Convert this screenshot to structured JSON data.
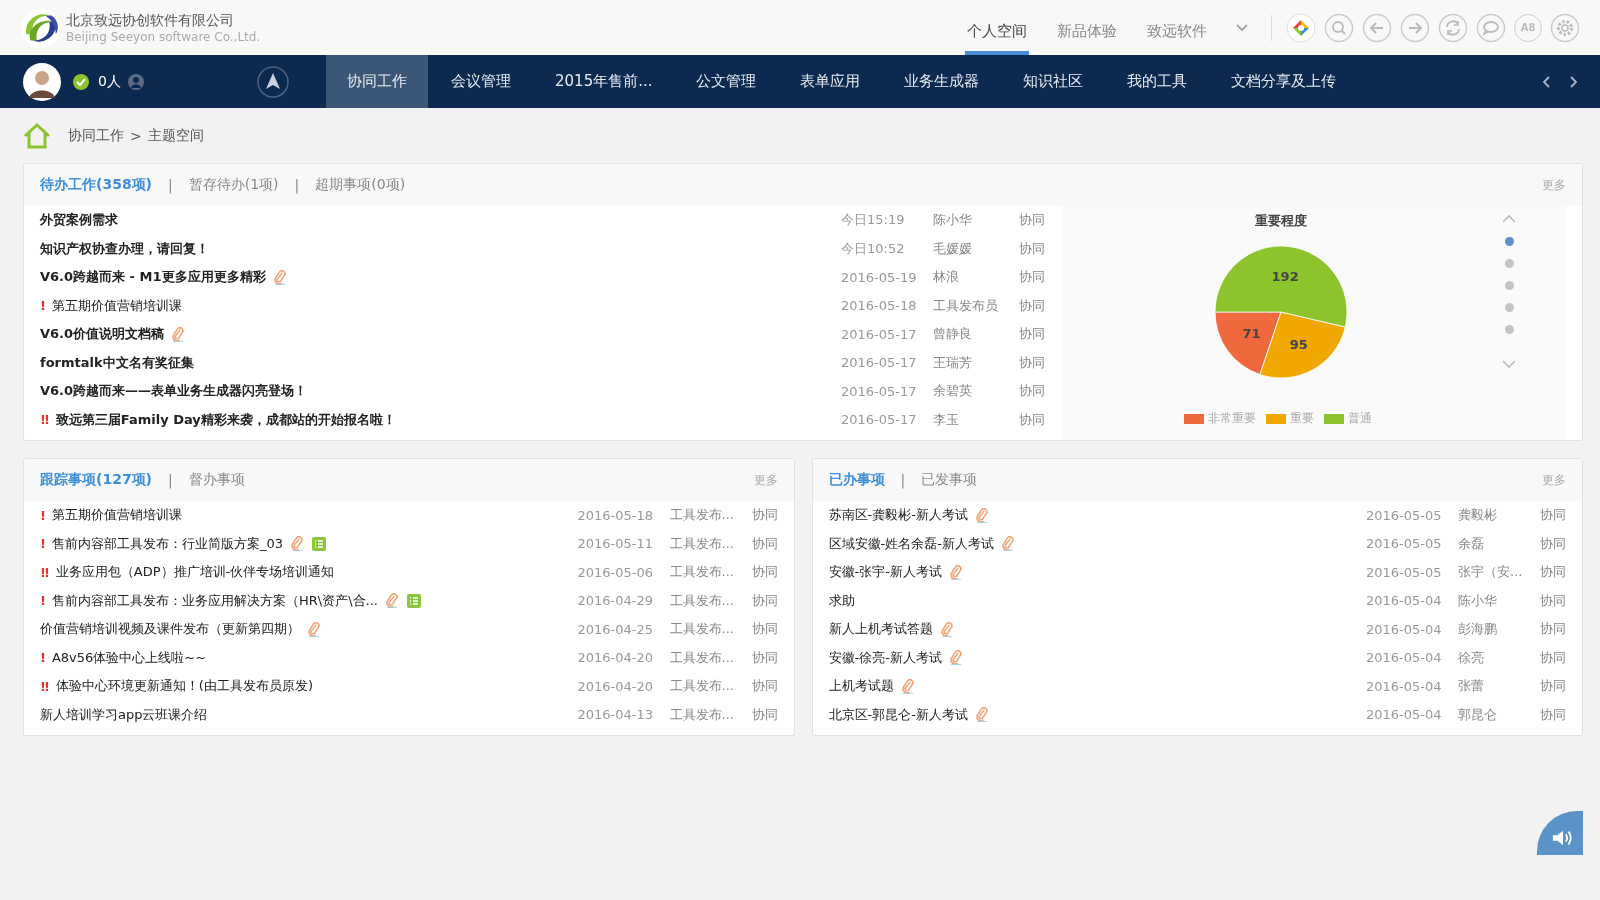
{
  "company": {
    "name": "北京致远协创软件有限公司",
    "name_en": "Beijing Seeyon software Co.,Ltd."
  },
  "top_nav": [
    {
      "label": "个人空间",
      "selected": true
    },
    {
      "label": "新品体验",
      "selected": false
    },
    {
      "label": "致远软件",
      "selected": false
    }
  ],
  "toolbar_badge": "A8",
  "user": {
    "online_count": "0人"
  },
  "main_nav": [
    {
      "label": "协同工作",
      "selected": true
    },
    {
      "label": "会议管理",
      "selected": false
    },
    {
      "label": "2015年售前...",
      "selected": false
    },
    {
      "label": "公文管理",
      "selected": false
    },
    {
      "label": "表单应用",
      "selected": false
    },
    {
      "label": "业务生成器",
      "selected": false
    },
    {
      "label": "知识社区",
      "selected": false
    },
    {
      "label": "我的工具",
      "selected": false
    },
    {
      "label": "文档分享及上传",
      "selected": false
    }
  ],
  "breadcrumb": [
    "协同工作",
    "主题空间"
  ],
  "breadcrumb_separator": ">",
  "pending": {
    "separator": "|",
    "tabs": [
      {
        "label": "待办工作(358项)",
        "selected": true
      },
      {
        "label": "暂存待办(1项)",
        "selected": false
      },
      {
        "label": "超期事项(0项)",
        "selected": false
      }
    ],
    "more": "更多",
    "rows": [
      {
        "title": "外贸案例需求",
        "bold": true,
        "attachment": false,
        "form": false,
        "date": "今日15:19",
        "person": "陈小华",
        "type": "协同"
      },
      {
        "title": "知识产权协查办理，请回复！",
        "bold": true,
        "attachment": false,
        "form": false,
        "date": "今日10:52",
        "person": "毛媛媛",
        "type": "协同"
      },
      {
        "title": "V6.0跨越而来 - M1更多应用更多精彩",
        "bold": true,
        "attachment": true,
        "form": false,
        "date": "2016-05-19",
        "person": "林浪",
        "type": "协同"
      },
      {
        "flag": "!",
        "title": "第五期价值营销培训课",
        "bold": false,
        "attachment": false,
        "form": false,
        "date": "2016-05-18",
        "person": "工具发布员",
        "type": "协同"
      },
      {
        "title": "V6.0价值说明文档稿",
        "bold": true,
        "attachment": true,
        "form": false,
        "date": "2016-05-17",
        "person": "曾静良",
        "type": "协同"
      },
      {
        "title": "formtalk中文名有奖征集",
        "bold": true,
        "attachment": false,
        "form": false,
        "date": "2016-05-17",
        "person": "王瑞芳",
        "type": "协同"
      },
      {
        "title": "V6.0跨越而来——表单业务生成器闪亮登场！",
        "bold": true,
        "attachment": false,
        "form": false,
        "date": "2016-05-17",
        "person": "余碧英",
        "type": "协同"
      },
      {
        "flag": "!!",
        "title": "致远第三届Family Day精彩来袭，成都站的开始报名啦！",
        "bold": true,
        "attachment": false,
        "form": false,
        "date": "2016-05-17",
        "person": "李玉",
        "type": "协同"
      }
    ],
    "chart_data": {
      "type": "pie",
      "title": "重要程度",
      "categories": [
        "非常重要",
        "重要",
        "普通"
      ],
      "values": [
        71,
        95,
        192
      ],
      "colors": [
        "#f0683e",
        "#f0a800",
        "#8dc42e"
      ],
      "data_labels": true,
      "legend": "bottom"
    },
    "pager": [
      {
        "selected": true
      },
      {
        "selected": false
      },
      {
        "selected": false
      },
      {
        "selected": false
      },
      {
        "selected": false
      }
    ]
  },
  "tracking": {
    "separator": "|",
    "tabs": [
      {
        "label": "跟踪事项(127项)",
        "selected": true
      },
      {
        "label": "督办事项",
        "selected": false
      }
    ],
    "more": "更多",
    "rows": [
      {
        "flag": "!",
        "title": "第五期价值营销培训课",
        "bold": false,
        "attachment": false,
        "form": false,
        "date": "2016-05-18",
        "person": "工具发布...",
        "type": "协同"
      },
      {
        "flag": "!",
        "title": "售前内容部工具发布：行业简版方案_03",
        "bold": false,
        "attachment": true,
        "form": true,
        "date": "2016-05-11",
        "person": "工具发布...",
        "type": "协同"
      },
      {
        "flag": "!!",
        "title": "业务应用包（ADP）推广培训-伙伴专场培训通知",
        "bold": false,
        "attachment": false,
        "form": false,
        "date": "2016-05-06",
        "person": "工具发布...",
        "type": "协同"
      },
      {
        "flag": "!",
        "title": "售前内容部工具发布：业务应用解决方案（HR\\资产\\合...",
        "bold": false,
        "attachment": true,
        "form": true,
        "date": "2016-04-29",
        "person": "工具发布...",
        "type": "协同"
      },
      {
        "title": "价值营销培训视频及课件发布（更新第四期）",
        "bold": false,
        "attachment": true,
        "form": false,
        "date": "2016-04-25",
        "person": "工具发布...",
        "type": "协同"
      },
      {
        "flag": "!",
        "title": "A8v56体验中心上线啦~~",
        "bold": false,
        "attachment": false,
        "form": false,
        "date": "2016-04-20",
        "person": "工具发布...",
        "type": "协同"
      },
      {
        "flag": "!!",
        "title": "体验中心环境更新通知！(由工具发布员原发)",
        "bold": false,
        "attachment": false,
        "form": false,
        "date": "2016-04-20",
        "person": "工具发布...",
        "type": "协同"
      },
      {
        "title": "新人培训学习app云班课介绍",
        "bold": false,
        "attachment": false,
        "form": false,
        "date": "2016-04-13",
        "person": "工具发布...",
        "type": "协同"
      }
    ]
  },
  "done": {
    "separator": "|",
    "tabs": [
      {
        "label": "已办事项",
        "selected": true
      },
      {
        "label": "已发事项",
        "selected": false
      }
    ],
    "more": "更多",
    "rows": [
      {
        "title": "苏南区-龚毅彬-新人考试",
        "bold": false,
        "attachment": true,
        "form": false,
        "date": "2016-05-05",
        "person": "龚毅彬",
        "type": "协同"
      },
      {
        "title": "区域安徽-姓名余磊-新人考试",
        "bold": false,
        "attachment": true,
        "form": false,
        "date": "2016-05-05",
        "person": "余磊",
        "type": "协同"
      },
      {
        "title": "安徽-张宇-新人考试",
        "bold": false,
        "attachment": true,
        "form": false,
        "date": "2016-05-05",
        "person": "张宇（安...",
        "type": "协同"
      },
      {
        "title": "求助",
        "bold": false,
        "attachment": false,
        "form": false,
        "date": "2016-05-04",
        "person": "陈小华",
        "type": "协同"
      },
      {
        "title": "新人上机考试答题",
        "bold": false,
        "attachment": true,
        "form": false,
        "date": "2016-05-04",
        "person": "彭海鹏",
        "type": "协同"
      },
      {
        "title": "安徽-徐亮-新人考试",
        "bold": false,
        "attachment": true,
        "form": false,
        "date": "2016-05-04",
        "person": "徐亮",
        "type": "协同"
      },
      {
        "title": "上机考试题",
        "bold": false,
        "attachment": true,
        "form": false,
        "date": "2016-05-04",
        "person": "张蕾",
        "type": "协同"
      },
      {
        "title": "北京区-郭昆仑-新人考试",
        "bold": false,
        "attachment": true,
        "form": false,
        "date": "2016-05-04",
        "person": "郭昆仑",
        "type": "协同"
      }
    ]
  }
}
